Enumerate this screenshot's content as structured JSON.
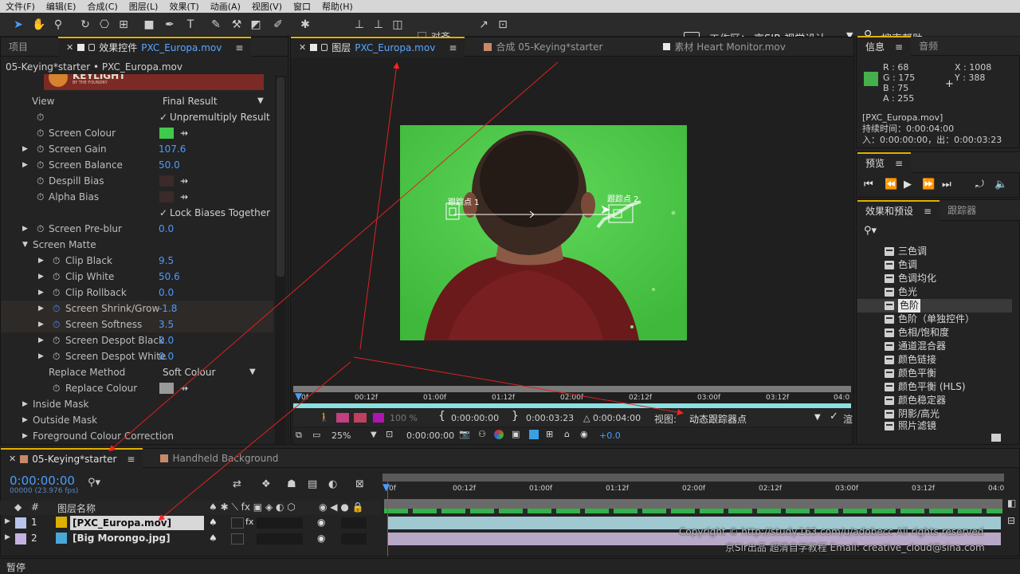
{
  "menubar": [
    "文件(F)",
    "编辑(E)",
    "合成(C)",
    "图层(L)",
    "效果(T)",
    "动画(A)",
    "视图(V)",
    "窗口",
    "帮助(H)"
  ],
  "toolbar": {
    "snap_label": "对齐",
    "workspace_label": "工作区：",
    "workspace_value": "京SIR 视觉设计",
    "search_help": "搜索帮助"
  },
  "left_panel": {
    "tab_project": "项目",
    "tab_effects_prefix": "效果控件",
    "tab_effects_layer": "PXC_Europa.mov",
    "breadcrumb": "05-Keying*starter • PXC_Europa.mov",
    "keylight_banner": "KEYLIGHT",
    "keylight_sub": "BY THE FOUNDRY",
    "props": {
      "view_label": "View",
      "view_value": "Final Result",
      "unpremultiply": "Unpremultiply Result",
      "screen_colour": "Screen Colour",
      "screen_gain": "Screen Gain",
      "screen_gain_val": "107.6",
      "screen_balance": "Screen Balance",
      "screen_balance_val": "50.0",
      "despill_bias": "Despill Bias",
      "alpha_bias": "Alpha Bias",
      "lock_biases": "Lock Biases Together",
      "screen_preblur": "Screen Pre-blur",
      "screen_preblur_val": "0.0",
      "screen_matte": "Screen Matte",
      "clip_black": "Clip Black",
      "clip_black_val": "9.5",
      "clip_white": "Clip White",
      "clip_white_val": "50.6",
      "clip_rollback": "Clip Rollback",
      "clip_rollback_val": "0.0",
      "shrink_grow": "Screen Shrink/Grow",
      "shrink_grow_val": "-1.8",
      "softness": "Screen Softness",
      "softness_val": "3.5",
      "despot_black": "Screen Despot Black",
      "despot_black_val": "0.0",
      "despot_white": "Screen Despot White",
      "despot_white_val": "0.0",
      "replace_method": "Replace Method",
      "replace_method_val": "Soft Colour",
      "replace_colour": "Replace Colour",
      "inside_mask": "Inside Mask",
      "outside_mask": "Outside Mask",
      "fg_correction": "Foreground Colour Correction"
    },
    "colors": {
      "screen_colour": "#41c94c",
      "despill": "#3a2a28",
      "replace": "#9a9a9a"
    }
  },
  "viewer": {
    "tab_layer_prefix": "图层",
    "tab_layer_name": "PXC_Europa.mov",
    "tab_comp": "合成 05-Keying*starter",
    "tab_footage": "素材 Heart Monitor.mov",
    "track_point_1": "跟踪点 1",
    "track_point_2": "跟踪点 2",
    "ruler_labels": [
      "0f",
      "00:12f",
      "01:00f",
      "01:12f",
      "02:00f",
      "02:12f",
      "03:00f",
      "03:12f",
      "04:0"
    ],
    "zoom_pct": "100 %",
    "in_time": "0:00:00:00",
    "out_time": "0:00:03:23",
    "duration": "△ 0:00:04:00",
    "view_label": "视图:",
    "view_value": "动态跟踪器点",
    "mag": "25%",
    "current_time": "0:00:00:00",
    "exposure": "+0.0"
  },
  "info": {
    "tab_info": "信息",
    "tab_audio": "音频",
    "r": "R : 68",
    "g": "G : 175",
    "b": "B : 75",
    "a": "A : 255",
    "x": "X : 1008",
    "y": "Y : 388",
    "file": "[PXC_Europa.mov]",
    "duration": "持续时间：0:00:04:00",
    "inout": "入：0:00:00:00，出：0:00:03:23",
    "swatch": "#44af4b"
  },
  "preview": {
    "tab": "预览"
  },
  "effects_presets": {
    "tab": "效果和预设",
    "tab_tracker": "跟踪器",
    "items": [
      "三色调",
      "色调",
      "色调均化",
      "色光",
      "色阶",
      "色阶（单独控件）",
      "色相/饱和度",
      "通道混合器",
      "颜色链接",
      "颜色平衡",
      "颜色平衡 (HLS)",
      "颜色稳定器",
      "阴影/高光",
      "照片滤镜"
    ],
    "selected_index": 4
  },
  "timeline": {
    "tab_comp": "05-Keying*starter",
    "tab_bg": "Handheld Background",
    "timecode": "0:00:00:00",
    "fps": "00000 (23.976 fps)",
    "col_num": "#",
    "col_name": "图层名称",
    "ruler_labels": [
      "0f",
      "00:12f",
      "01:00f",
      "01:12f",
      "02:00f",
      "02:12f",
      "03:00f",
      "03:12f",
      "04:0"
    ],
    "layers": [
      {
        "num": "1",
        "name": "[PXC_Europa.mov]",
        "color": "#b7c3e8"
      },
      {
        "num": "2",
        "name": "[Big Morongo.jpg]",
        "color": "#c4b3e0"
      }
    ]
  },
  "watermark": {
    "line1": "Copyright © http://study.163.com/u/adobecc All rights reserved",
    "line2": "京Sir出品  超清自学教程  Email: creative_cloud@sina.com"
  },
  "status": "暂停"
}
